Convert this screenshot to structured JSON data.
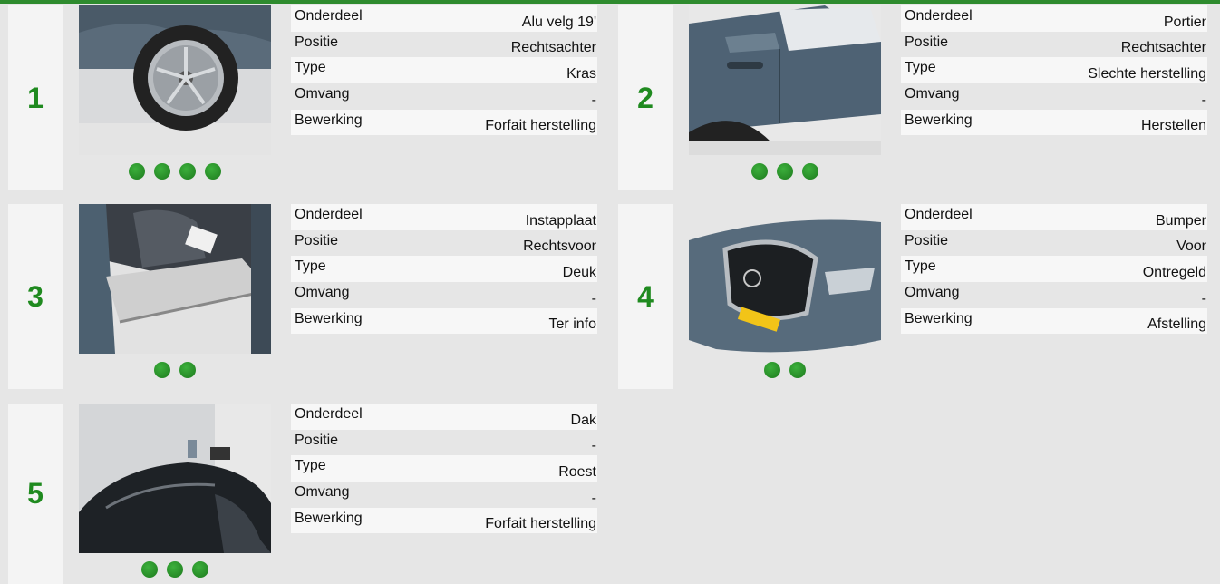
{
  "colors": {
    "accent": "#1f8a1f",
    "topbar": "#2e8b2e",
    "background": "#e6e6e6"
  },
  "labels": [
    "Onderdeel",
    "Positie",
    "Type",
    "Omvang",
    "Bewerking"
  ],
  "items": [
    {
      "number": "1",
      "values": [
        "Alu velg 19'",
        "Rechtsachter",
        "Kras",
        "-",
        "Forfait herstelling"
      ],
      "dots": 4,
      "photo": "wheel"
    },
    {
      "number": "2",
      "values": [
        "Portier",
        "Rechtsachter",
        "Slechte herstelling",
        "-",
        "Herstellen"
      ],
      "dots": 3,
      "photo": "door"
    },
    {
      "number": "3",
      "values": [
        "Instapplaat",
        "Rechtsvoor",
        "Deuk",
        "-",
        "Ter info"
      ],
      "dots": 2,
      "photo": "sill"
    },
    {
      "number": "4",
      "values": [
        "Bumper",
        "Voor",
        "Ontregeld",
        "-",
        "Afstelling"
      ],
      "dots": 2,
      "photo": "front"
    },
    {
      "number": "5",
      "values": [
        "Dak",
        "-",
        "Roest",
        "-",
        "Forfait herstelling"
      ],
      "dots": 3,
      "photo": "roof"
    }
  ]
}
